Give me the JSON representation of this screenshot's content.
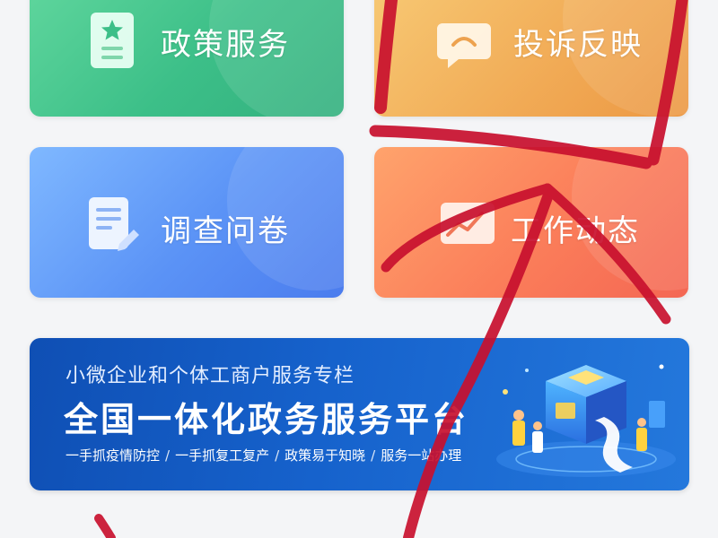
{
  "tiles": {
    "policy": {
      "label": "政策服务",
      "icon": "policy-document-star-icon",
      "color": "#3cbf88"
    },
    "complaint": {
      "label": "投诉反映",
      "icon": "chat-bubble-icon",
      "color": "#f1aa55"
    },
    "survey": {
      "label": "调查问卷",
      "icon": "questionnaire-edit-icon",
      "color": "#5b93f6"
    },
    "news": {
      "label": "工作动态",
      "icon": "trend-chart-icon",
      "color": "#fb7e5a"
    }
  },
  "banner": {
    "subtitle": "小微企业和个体工商户服务专栏",
    "title": "全国一体化政务服务平台",
    "tags": [
      "一手抓疫情防控",
      "一手抓复工复产",
      "政策易于知晓",
      "服务一站办理"
    ],
    "tag_separator": "/",
    "illustration": "government-service-platform-illustration",
    "color": "#1662cc"
  },
  "annotation": {
    "icon": "red-hand-drawn-arrow-overlay",
    "color": "#c8102e"
  }
}
